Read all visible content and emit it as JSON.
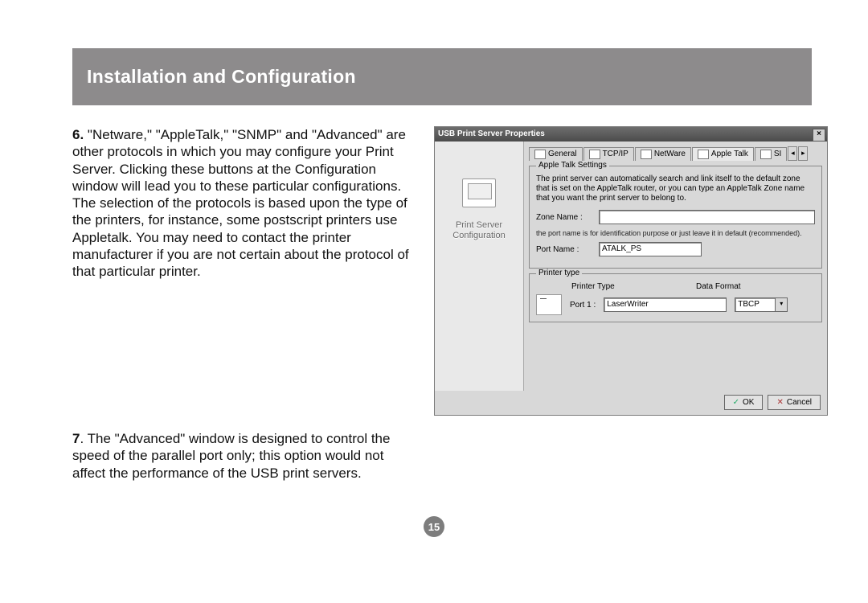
{
  "header": {
    "title": "Installation and Configuration"
  },
  "steps": {
    "six_num": "6.",
    "six_text": " \"Netware,\" \"AppleTalk,\" \"SNMP\" and \"Advanced\" are other protocols in which you may configure your Print Server. Clicking these buttons at the Configuration window will lead you to these particular configurations. The selection of the protocols is based upon the type of the printers, for instance, some postscript printers use Appletalk. You may need to contact the printer manufacturer if you are not certain about the protocol of that particular printer.",
    "seven_num": "7",
    "seven_text": ". The \"Advanced\" window is designed to control the speed of the parallel port only; this option would not affect the performance of the USB print servers."
  },
  "dialog": {
    "title": "USB Print Server Properties",
    "close": "×",
    "sidebar_label_1": "Print Server",
    "sidebar_label_2": "Configuration",
    "tabs": {
      "general": "General",
      "tcpip": "TCP/IP",
      "netware": "NetWare",
      "appletalk": "Apple Talk",
      "snmp": "SI",
      "nav_left": "◂",
      "nav_right": "▸"
    },
    "appletalk": {
      "group_title": "Apple Talk Settings",
      "desc": "The print server can automatically search and link itself to the default zone that is set on the AppleTalk router, or you can type an AppleTalk Zone name that you want the print server to belong to.",
      "zone_label": "Zone Name :",
      "zone_value": "",
      "port_note": "the port name is for identification purpose or just leave it in default (recommended).",
      "port_label": "Port Name :",
      "port_value": "ATALK_PS"
    },
    "printer": {
      "group_title": "Printer type",
      "col_type": "Printer Type",
      "col_format": "Data Format",
      "row_label": "Port 1 :",
      "type_value": "LaserWriter",
      "fmt_value": "TBCP",
      "dropdown_arrow": "▾"
    },
    "buttons": {
      "ok": "OK",
      "cancel": "Cancel"
    }
  },
  "page_number": "15"
}
